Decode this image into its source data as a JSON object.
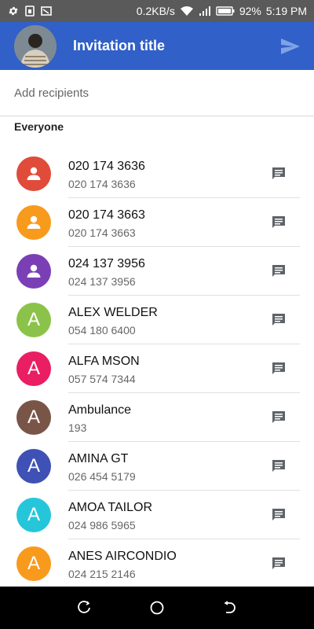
{
  "status_bar": {
    "net_speed": "0.2KB/s",
    "battery": "92%",
    "time": "5:19 PM"
  },
  "header": {
    "title": "Invitation title"
  },
  "recipients": {
    "placeholder": "Add recipients"
  },
  "section": {
    "title": "Everyone"
  },
  "contacts": [
    {
      "name": "020 174 3636",
      "phone": "020 174 3636",
      "initial": "",
      "icon": "person-icon",
      "color": "#e04b3a"
    },
    {
      "name": "020 174 3663",
      "phone": "020 174 3663",
      "initial": "",
      "icon": "person-icon",
      "color": "#f89a1c"
    },
    {
      "name": "024 137 3956",
      "phone": "024 137 3956",
      "initial": "",
      "icon": "person-icon",
      "color": "#7b3fb5"
    },
    {
      "name": "ALEX WELDER",
      "phone": "054 180 6400",
      "initial": "A",
      "icon": "",
      "color": "#8bc34a"
    },
    {
      "name": "ALFA MSON",
      "phone": "057 574 7344",
      "initial": "A",
      "icon": "",
      "color": "#e91e63"
    },
    {
      "name": "Ambulance",
      "phone": "193",
      "initial": "A",
      "icon": "",
      "color": "#795548"
    },
    {
      "name": "AMINA GT",
      "phone": "026 454 5179",
      "initial": "A",
      "icon": "",
      "color": "#3f51b5"
    },
    {
      "name": "AMOA TAILOR",
      "phone": "024 986 5965",
      "initial": "A",
      "icon": "",
      "color": "#26c6da"
    },
    {
      "name": "ANES AIRCONDIO",
      "phone": "024 215 2146",
      "initial": "A",
      "icon": "",
      "color": "#f89a1c"
    }
  ],
  "colors": {
    "app_bar": "#3060c8",
    "status_bar": "#5a5a5a",
    "message_icon": "#5f6368"
  }
}
